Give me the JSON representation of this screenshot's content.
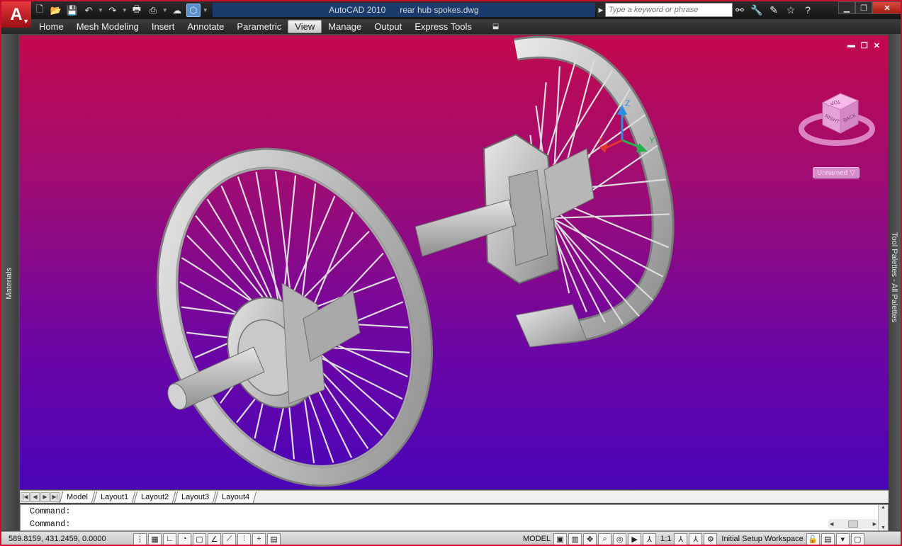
{
  "app": {
    "logo_letter": "A",
    "logo_arrow": "▼",
    "name": "AutoCAD 2010",
    "file": "rear hub spokes.dwg"
  },
  "qat": {
    "icons": [
      "new-icon",
      "open-icon",
      "save-icon",
      "undo-icon",
      "redo-icon",
      "plot-icon",
      "publish-icon",
      "workspace-icon",
      "active-workspace-icon"
    ],
    "glyphs": [
      "🗋",
      "📂",
      "💾",
      "↶",
      "↷",
      "🖶",
      "⎙",
      "☁",
      "⬡"
    ],
    "expand_glyph": "▼"
  },
  "search": {
    "placeholder": "Type a keyword or phrase",
    "arrow_glyph": "▶"
  },
  "help_tools": {
    "glyphs": [
      "⚯",
      "🔧",
      "✎",
      "☆",
      "?"
    ],
    "icons": [
      "binoculars-icon",
      "communication-icon",
      "subscription-icon",
      "favorites-icon",
      "help-icon"
    ]
  },
  "window_controls": {
    "min": "▁",
    "max": "❐",
    "close": "✕"
  },
  "menus": [
    {
      "label": "Home"
    },
    {
      "label": "Mesh Modeling"
    },
    {
      "label": "Insert"
    },
    {
      "label": "Annotate"
    },
    {
      "label": "Parametric"
    },
    {
      "label": "View",
      "active": true
    },
    {
      "label": "Manage"
    },
    {
      "label": "Output"
    },
    {
      "label": "Express Tools"
    }
  ],
  "menu_extra_glyph": "⬓",
  "panels": {
    "left": "Materials",
    "right": "Tool Palettes - All Palettes"
  },
  "viewport": {
    "controls": {
      "min": "▬",
      "max": "❐",
      "close": "✕"
    },
    "bg_top": "#c3094e",
    "bg_bottom": "#4b05b8"
  },
  "viewcube": {
    "top": "TOP",
    "right": "RIGHT",
    "back": "BACK",
    "view_name": "Unnamed",
    "view_arrow": "▽"
  },
  "ucs": {
    "x": "X",
    "y": "Y",
    "z": "Z"
  },
  "layout_tabs": [
    {
      "label": "Model",
      "active": true
    },
    {
      "label": "Layout1"
    },
    {
      "label": "Layout2"
    },
    {
      "label": "Layout3"
    },
    {
      "label": "Layout4"
    }
  ],
  "tab_nav": [
    "|◀",
    "◀",
    "▶",
    "▶|"
  ],
  "command": {
    "line1": "Command:",
    "line2": "Command:"
  },
  "status": {
    "coords": "589.8159, 431.2459, 0.0000",
    "model": "MODEL",
    "scale": "1:1",
    "workspace": "Initial Setup Workspace"
  }
}
